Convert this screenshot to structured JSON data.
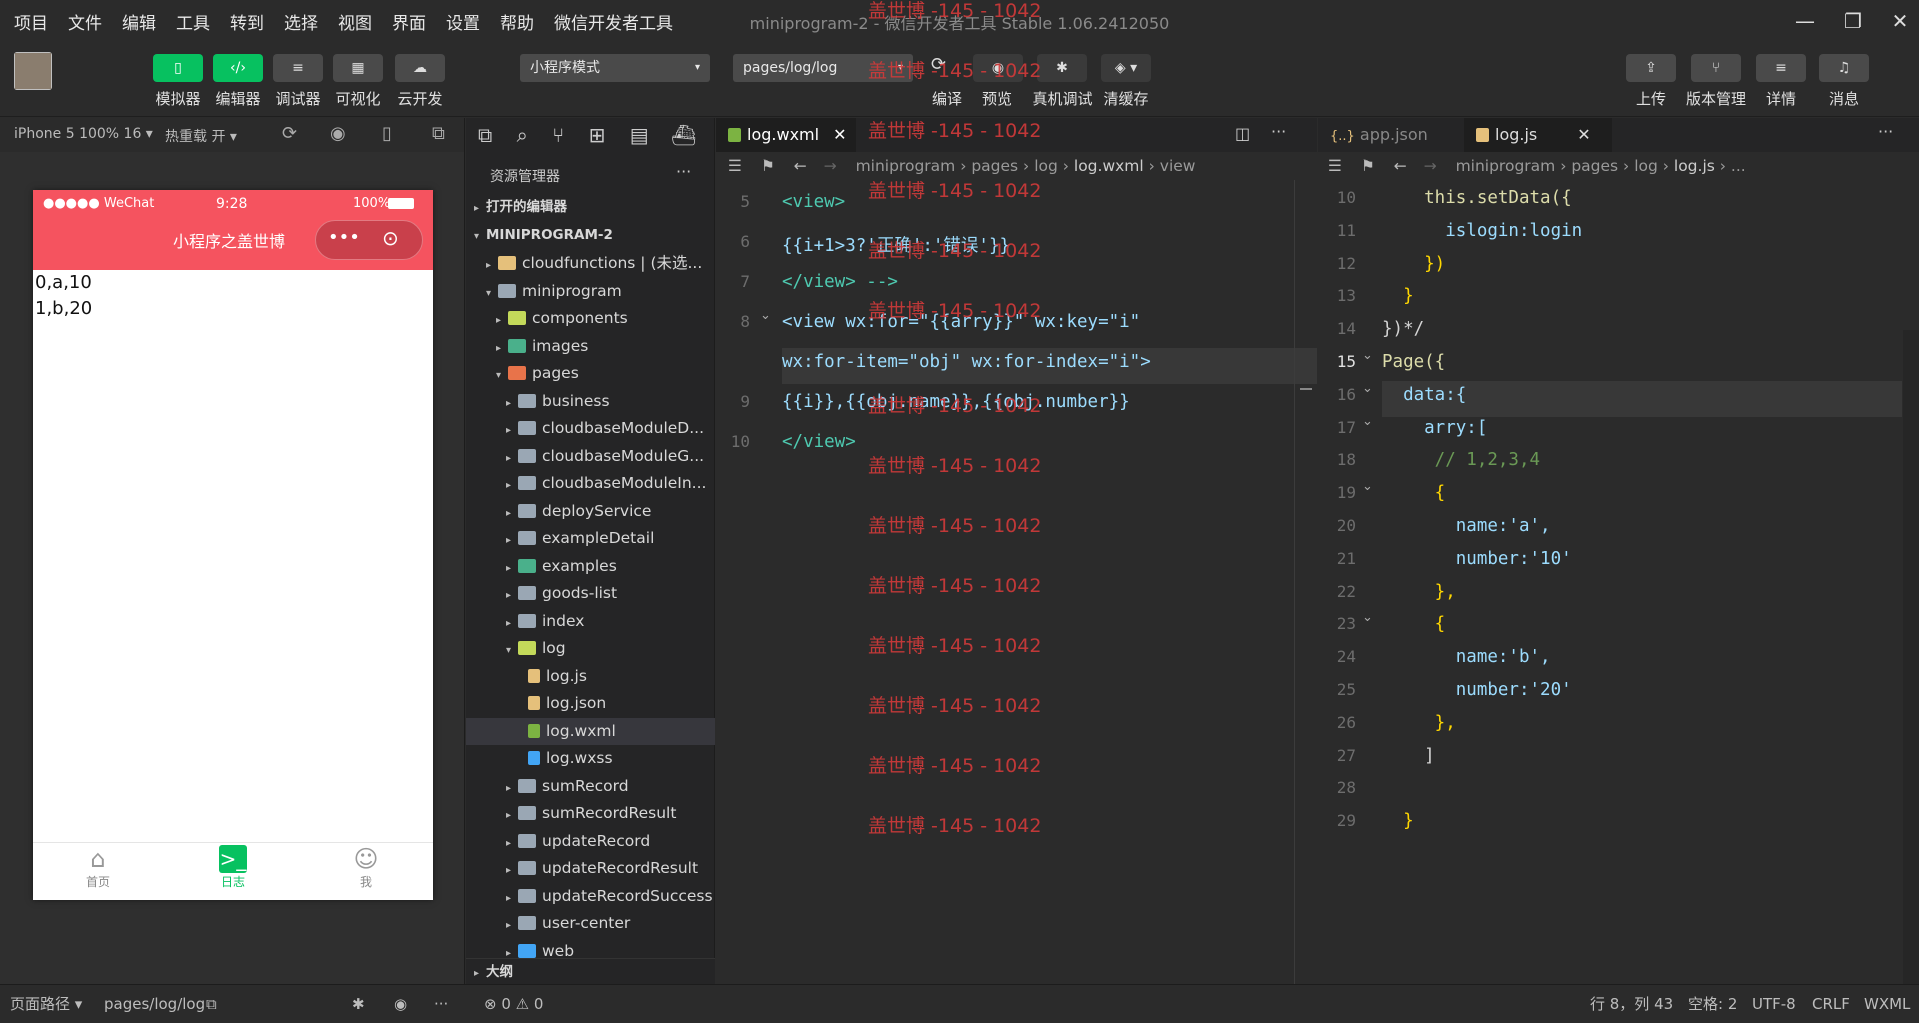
{
  "menu": [
    "项目",
    "文件",
    "编辑",
    "工具",
    "转到",
    "选择",
    "视图",
    "界面",
    "设置",
    "帮助",
    "微信开发者工具"
  ],
  "window_title": "miniprogram-2 - 微信开发者工具 Stable 1.06.2412050",
  "toolbar": {
    "left_buttons": [
      "模拟器",
      "编辑器",
      "调试器",
      "可视化",
      "云开发"
    ],
    "mode_select": "小程序模式",
    "page_select": "pages/log/log",
    "center_buttons": [
      "编译",
      "预览",
      "真机调试",
      "清缓存"
    ],
    "right_buttons": [
      "上传",
      "版本管理",
      "详情",
      "消息"
    ]
  },
  "simbar": {
    "device": "iPhone 5 100% 16 ▾",
    "hotreload": "热重载 开 ▾"
  },
  "phone": {
    "status_left": "●●●●● WeChat",
    "time": "9:28",
    "battery": "100%",
    "title": "小程序之盖世博",
    "lines": [
      "0,a,10",
      "1,b,20"
    ],
    "tabs": [
      "首页",
      "日志",
      "我"
    ]
  },
  "explorer": {
    "title": "资源管理器",
    "open_editors": "打开的编辑器",
    "project": "MINIPROGRAM-2",
    "items": [
      {
        "label": "cloudfunctions | (未选...",
        "depth": 1,
        "arrow": "▸",
        "color": "#e5c07b"
      },
      {
        "label": "miniprogram",
        "depth": 1,
        "arrow": "▾",
        "color": "#9aa7b4"
      },
      {
        "label": "components",
        "depth": 2,
        "arrow": "▸",
        "color": "#c3d95a"
      },
      {
        "label": "images",
        "depth": 2,
        "arrow": "▸",
        "color": "#4ab08b"
      },
      {
        "label": "pages",
        "depth": 2,
        "arrow": "▾",
        "color": "#e8734a"
      },
      {
        "label": "business",
        "depth": 3,
        "arrow": "▸",
        "color": "#9aa7b4"
      },
      {
        "label": "cloudbaseModuleD...",
        "depth": 3,
        "arrow": "▸",
        "color": "#9aa7b4"
      },
      {
        "label": "cloudbaseModuleG...",
        "depth": 3,
        "arrow": "▸",
        "color": "#9aa7b4"
      },
      {
        "label": "cloudbaseModuleIn...",
        "depth": 3,
        "arrow": "▸",
        "color": "#9aa7b4"
      },
      {
        "label": "deployService",
        "depth": 3,
        "arrow": "▸",
        "color": "#9aa7b4"
      },
      {
        "label": "exampleDetail",
        "depth": 3,
        "arrow": "▸",
        "color": "#9aa7b4"
      },
      {
        "label": "examples",
        "depth": 3,
        "arrow": "▸",
        "color": "#4ab08b"
      },
      {
        "label": "goods-list",
        "depth": 3,
        "arrow": "▸",
        "color": "#9aa7b4"
      },
      {
        "label": "index",
        "depth": 3,
        "arrow": "▸",
        "color": "#9aa7b4"
      },
      {
        "label": "log",
        "depth": 3,
        "arrow": "▾",
        "color": "#c3d95a"
      },
      {
        "label": "log.js",
        "depth": 4,
        "arrow": "",
        "color": "#e5c07b"
      },
      {
        "label": "log.json",
        "depth": 4,
        "arrow": "",
        "color": "#e5c07b"
      },
      {
        "label": "log.wxml",
        "depth": 4,
        "arrow": "",
        "color": "#7cb342",
        "selected": true
      },
      {
        "label": "log.wxss",
        "depth": 4,
        "arrow": "",
        "color": "#42a5f5"
      },
      {
        "label": "sumRecord",
        "depth": 3,
        "arrow": "▸",
        "color": "#9aa7b4"
      },
      {
        "label": "sumRecordResult",
        "depth": 3,
        "arrow": "▸",
        "color": "#9aa7b4"
      },
      {
        "label": "updateRecord",
        "depth": 3,
        "arrow": "▸",
        "color": "#9aa7b4"
      },
      {
        "label": "updateRecordResult",
        "depth": 3,
        "arrow": "▸",
        "color": "#9aa7b4"
      },
      {
        "label": "updateRecordSuccess",
        "depth": 3,
        "arrow": "▸",
        "color": "#9aa7b4"
      },
      {
        "label": "user-center",
        "depth": 3,
        "arrow": "▸",
        "color": "#9aa7b4"
      },
      {
        "label": "web",
        "depth": 3,
        "arrow": "▸",
        "color": "#42a5f5"
      }
    ],
    "outline": "大纲"
  },
  "editor1": {
    "tab": "log.wxml",
    "crumbs": [
      "miniprogram",
      "pages",
      "log",
      "log.wxml",
      "view"
    ],
    "line_numbers": [
      "5",
      "6",
      "7",
      "8",
      "",
      "9",
      "10"
    ],
    "lines": [
      "<view>",
      "{{i+1>3?'正确':'错误'}}",
      "</view> -->",
      "<view wx:for=\"{{arry}}\" wx:key=\"i\"",
      "wx:for-item=\"obj\" wx:for-index=\"i\">",
      "{{i}},{{obj.name}},{{obj.number}}",
      "</view>"
    ]
  },
  "editor2": {
    "tabs": [
      "app.json",
      "log.js"
    ],
    "crumbs": [
      "miniprogram",
      "pages",
      "log",
      "log.js",
      "..."
    ],
    "line_numbers": [
      "10",
      "11",
      "12",
      "13",
      "14",
      "15",
      "16",
      "17",
      "18",
      "19",
      "20",
      "21",
      "22",
      "23",
      "24",
      "25",
      "26",
      "27",
      "28",
      "29"
    ],
    "lines": [
      "    this.setData({",
      "      islogin:login",
      "    })",
      "  }",
      "})*/",
      "Page({",
      "  data:{",
      "    arry:[",
      "     // 1,2,3,4",
      "     {",
      "       name:'a',",
      "       number:'10'",
      "     },",
      "     {",
      "       name:'b',",
      "       number:'20'",
      "     },",
      "    ]",
      "",
      "  }"
    ]
  },
  "watermark": "盖世博 -145 - 1042",
  "status": {
    "path_label": "页面路径 ▾",
    "path": "pages/log/log",
    "problems": "⊗ 0 ⚠ 0",
    "cursor": "行 8，列 43",
    "spaces": "空格: 2",
    "encoding": "UTF-8",
    "eol": "CRLF",
    "lang": "WXML"
  }
}
